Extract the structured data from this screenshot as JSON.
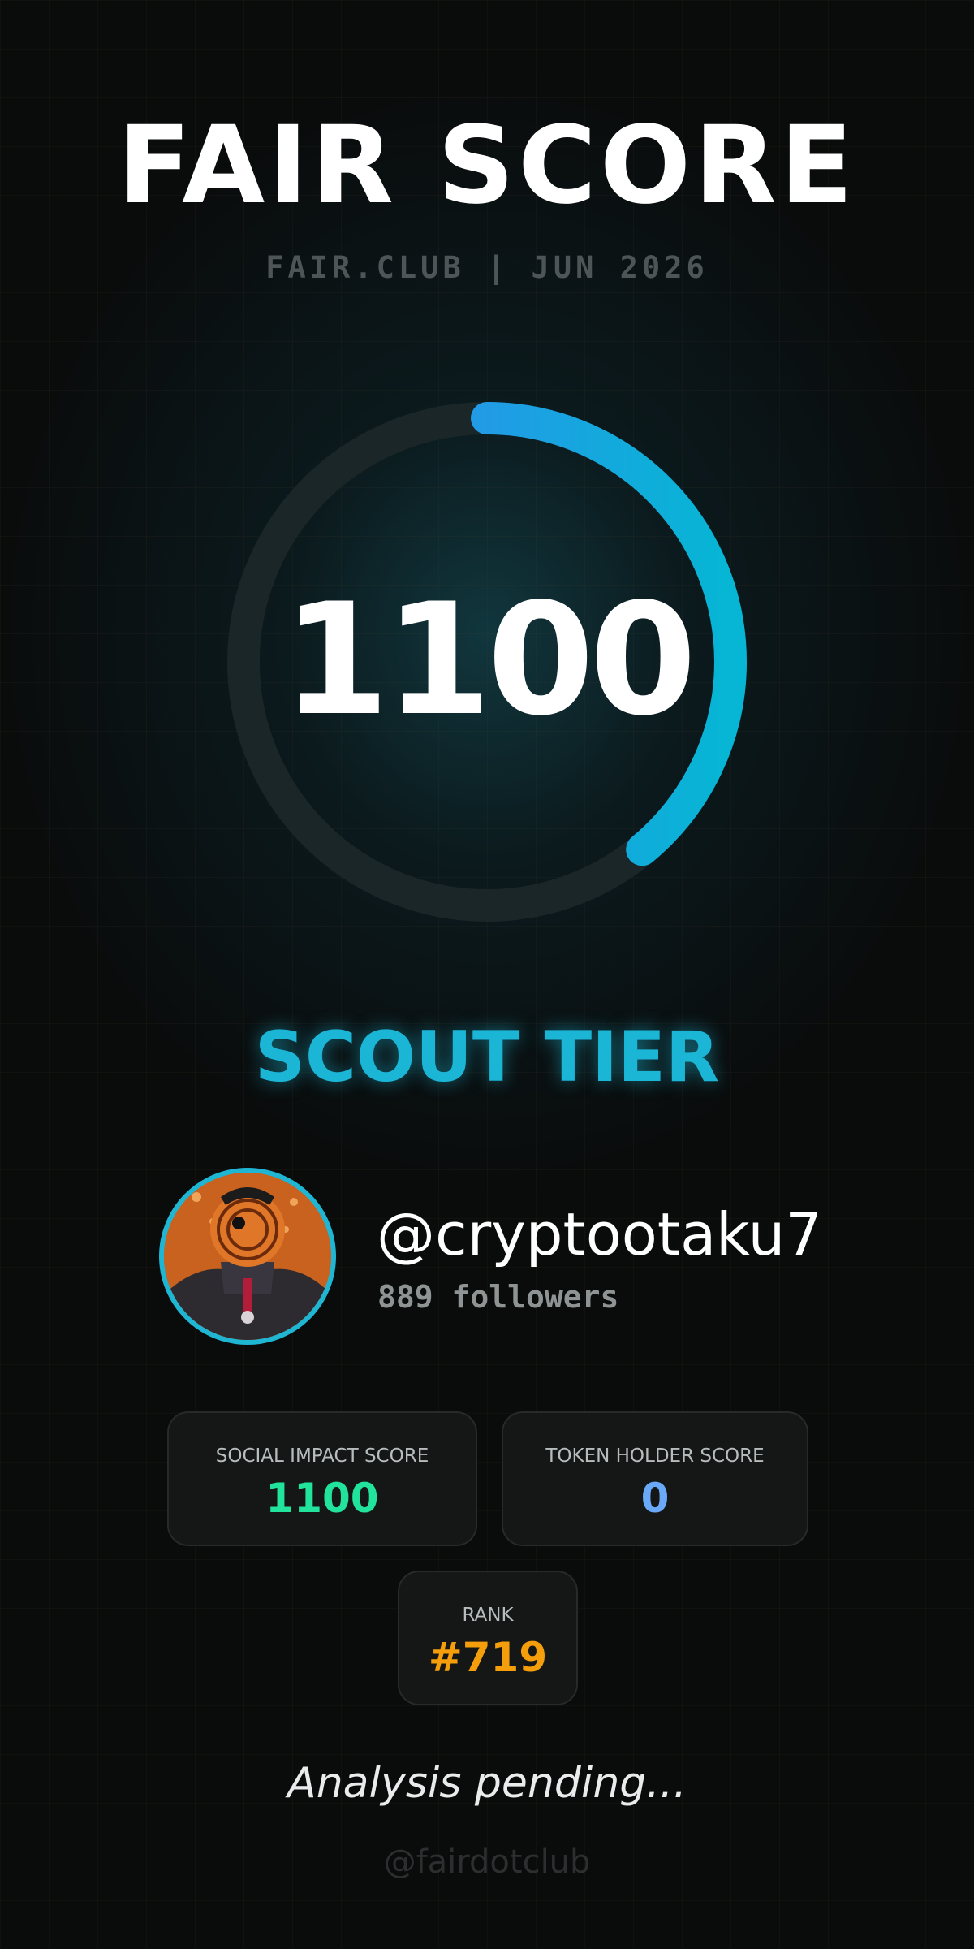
{
  "header": {
    "title": "FAIR SCORE",
    "subtitle": "FAIR.CLUB | JUN 2026"
  },
  "score": {
    "value": "1100",
    "gauge_fill_fraction": 0.39,
    "gauge_color_start": "#3b82f6",
    "gauge_color_end": "#06b6d4"
  },
  "tier": {
    "label": "SCOUT TIER",
    "color": "#1bb6d6"
  },
  "profile": {
    "handle": "@cryptootaku7",
    "followers": "889 followers",
    "avatar_icon": "masked-ninja-avatar"
  },
  "stats": {
    "social_impact": {
      "label": "SOCIAL IMPACT SCORE",
      "value": "1100",
      "color": "#22e39b"
    },
    "token_holder": {
      "label": "TOKEN HOLDER SCORE",
      "value": "0",
      "color": "#6aa8f8"
    },
    "rank": {
      "label": "RANK",
      "value": "#719",
      "color": "#f59e0b"
    }
  },
  "status_text": "Analysis pending...",
  "footer_handle": "@fairdotclub"
}
